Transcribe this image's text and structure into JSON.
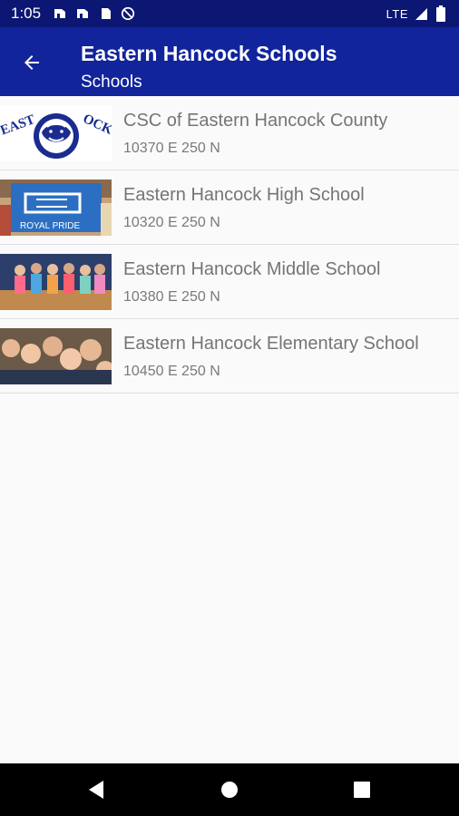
{
  "status_bar": {
    "time": "1:05",
    "network": "LTE",
    "icons": [
      "hanger-icon",
      "hanger-icon",
      "sd-card-icon",
      "no-disturb-icon",
      "signal-icon",
      "battery-icon"
    ]
  },
  "app_bar": {
    "title": "Eastern Hancock Schools",
    "subtitle": "Schools",
    "back_icon": "arrow-back-icon"
  },
  "schools": [
    {
      "name": "CSC of Eastern Hancock County",
      "address": "10370 E 250 N",
      "thumbnail": "royal-lion-logo"
    },
    {
      "name": "Eastern Hancock High School",
      "address": "10320 E 250 N",
      "thumbnail": "royal-pride-banner-photo"
    },
    {
      "name": "Eastern Hancock Middle School",
      "address": "10380 E 250 N",
      "thumbnail": "students-gym-photo"
    },
    {
      "name": "Eastern Hancock Elementary School",
      "address": "10450 E 250 N",
      "thumbnail": "kids-selfie-photo"
    }
  ],
  "nav_bar": {
    "buttons": [
      "back-triangle-icon",
      "home-circle-icon",
      "recents-square-icon"
    ]
  },
  "colors": {
    "status_bar": "#0b1773",
    "app_bar": "#11249b",
    "background": "#fafafa",
    "text_primary": "#757575",
    "nav_bar": "#000000"
  }
}
